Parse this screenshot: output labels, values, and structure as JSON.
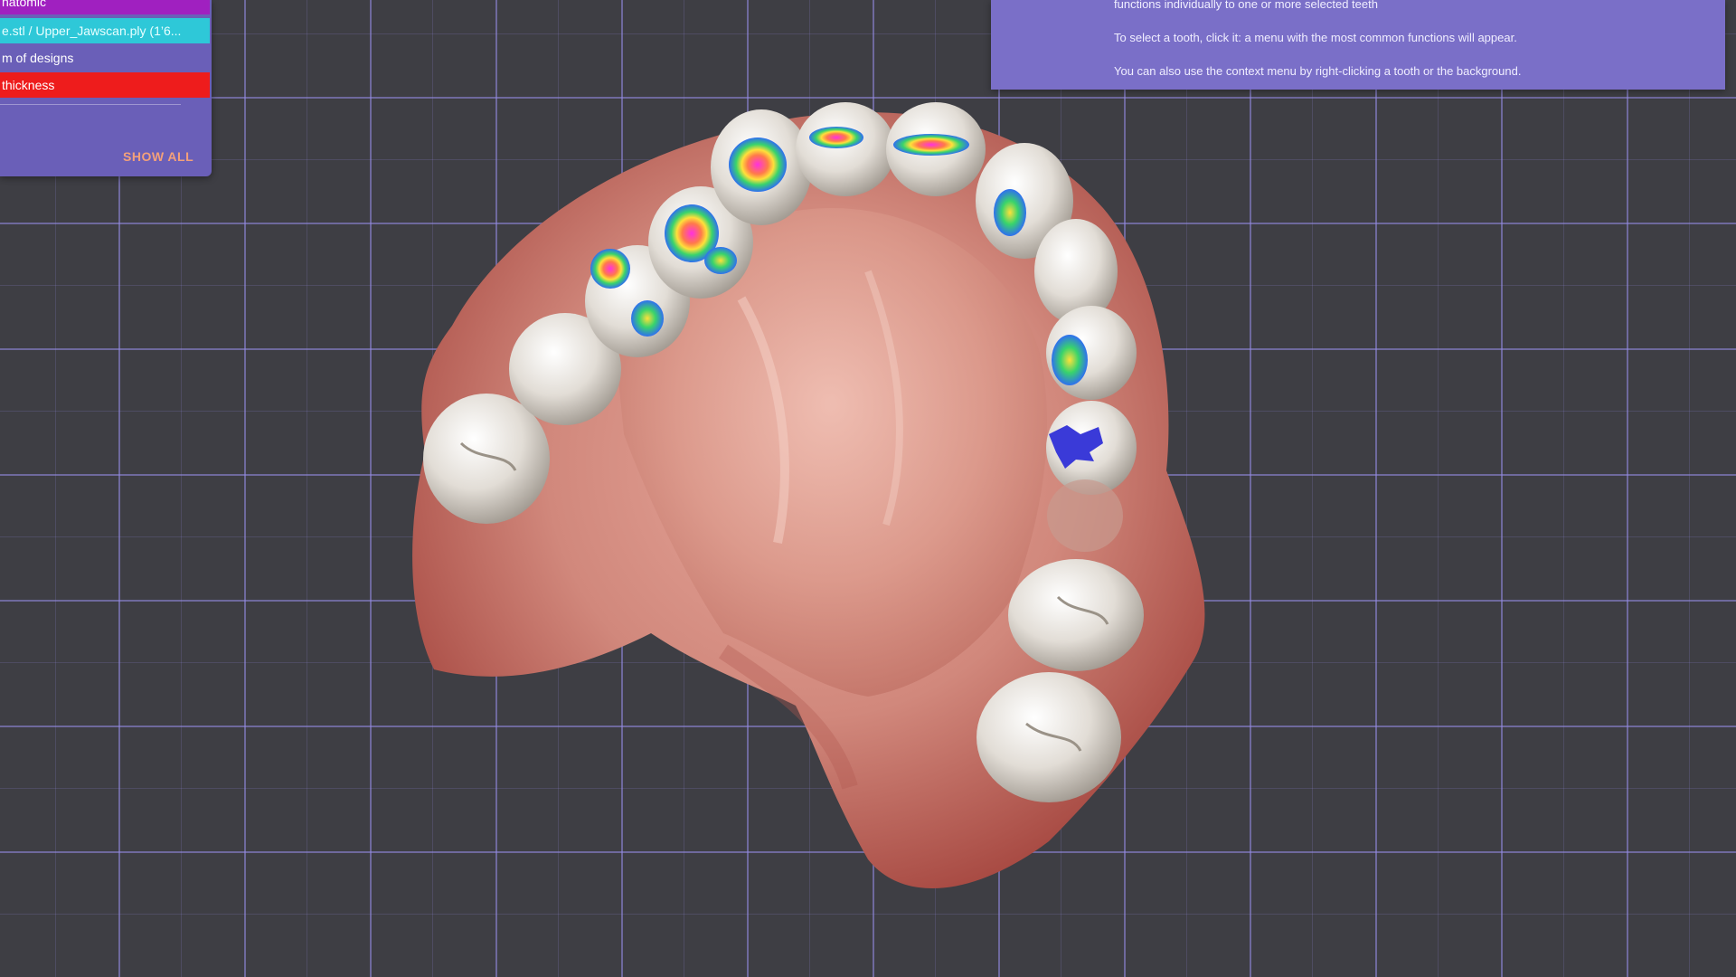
{
  "layers_panel": {
    "items": [
      {
        "label": "natomic",
        "color": "#a020c0"
      },
      {
        "label": "e.stl / Upper_Jawscan.ply (1’6...",
        "color": "#2ec8d8"
      },
      {
        "label": "m of designs",
        "color": ""
      },
      {
        "label": "thickness",
        "color": "#ee1c1c"
      }
    ],
    "show_all_label": "SHOW ALL"
  },
  "help_panel": {
    "lines": [
      "functions individually to one or more selected teeth",
      "To select a tooth, click it: a menu with the most common functions will appear.",
      "You can also use the context menu by right-clicking a tooth or the background."
    ]
  },
  "viewport": {
    "model": "upper-jaw-scan",
    "grid_color": "#968ce6",
    "background": "#3e3e44"
  }
}
